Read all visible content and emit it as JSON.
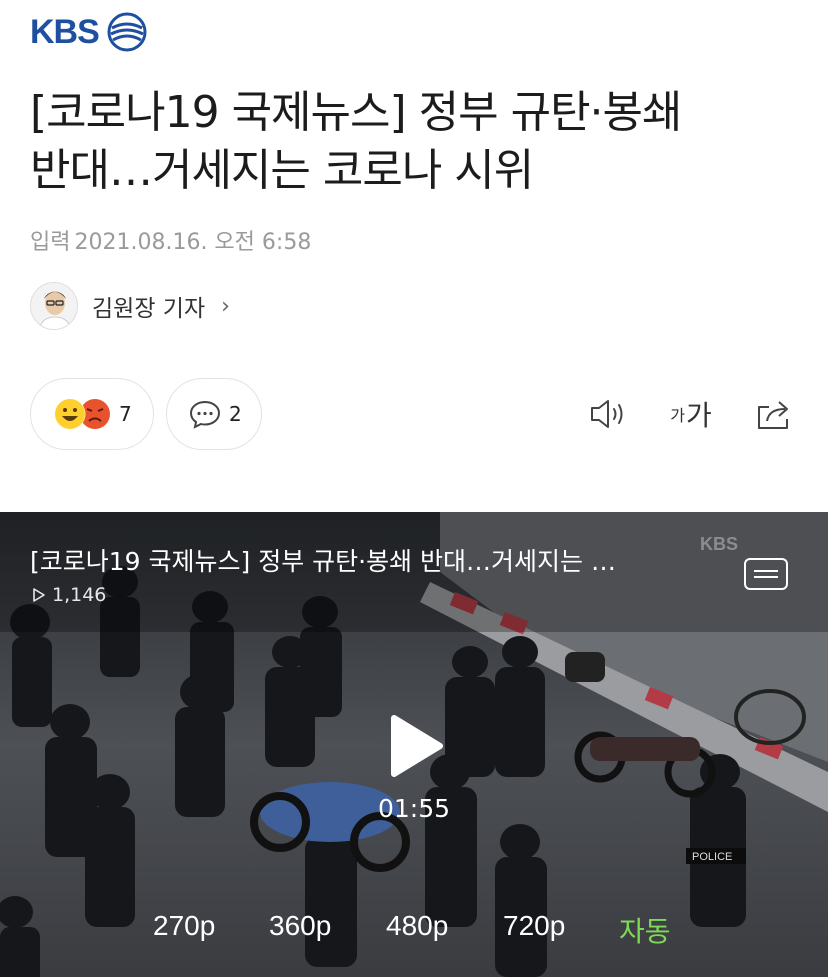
{
  "header": {
    "logo_text": "KBS",
    "brand_color": "#1e4fa0"
  },
  "article": {
    "title_line1": "[코로나19 국제뉴스] 정부 규탄·봉쇄",
    "title_line2": "반대…거세지는 코로나 시위",
    "meta_label": "입력",
    "meta_date": "2021.08.16. 오전 6:58"
  },
  "reporter": {
    "name": "김원장 기자",
    "chevron": "›"
  },
  "actions": {
    "reaction_count": "7",
    "comment_count": "2",
    "font_small": "가",
    "font_large": "가",
    "icons": [
      "speaker-icon",
      "font-size-icon",
      "share-icon"
    ]
  },
  "video": {
    "title": "[코로나19 국제뉴스] 정부 규탄·봉쇄 반대…거세지는 …",
    "views": "1,146",
    "duration": "01:55",
    "watermark": "KBS",
    "qualities": [
      "270p",
      "360p",
      "480p",
      "720p",
      "자동"
    ],
    "selected_quality": "자동",
    "selected_color": "#7ed957"
  }
}
